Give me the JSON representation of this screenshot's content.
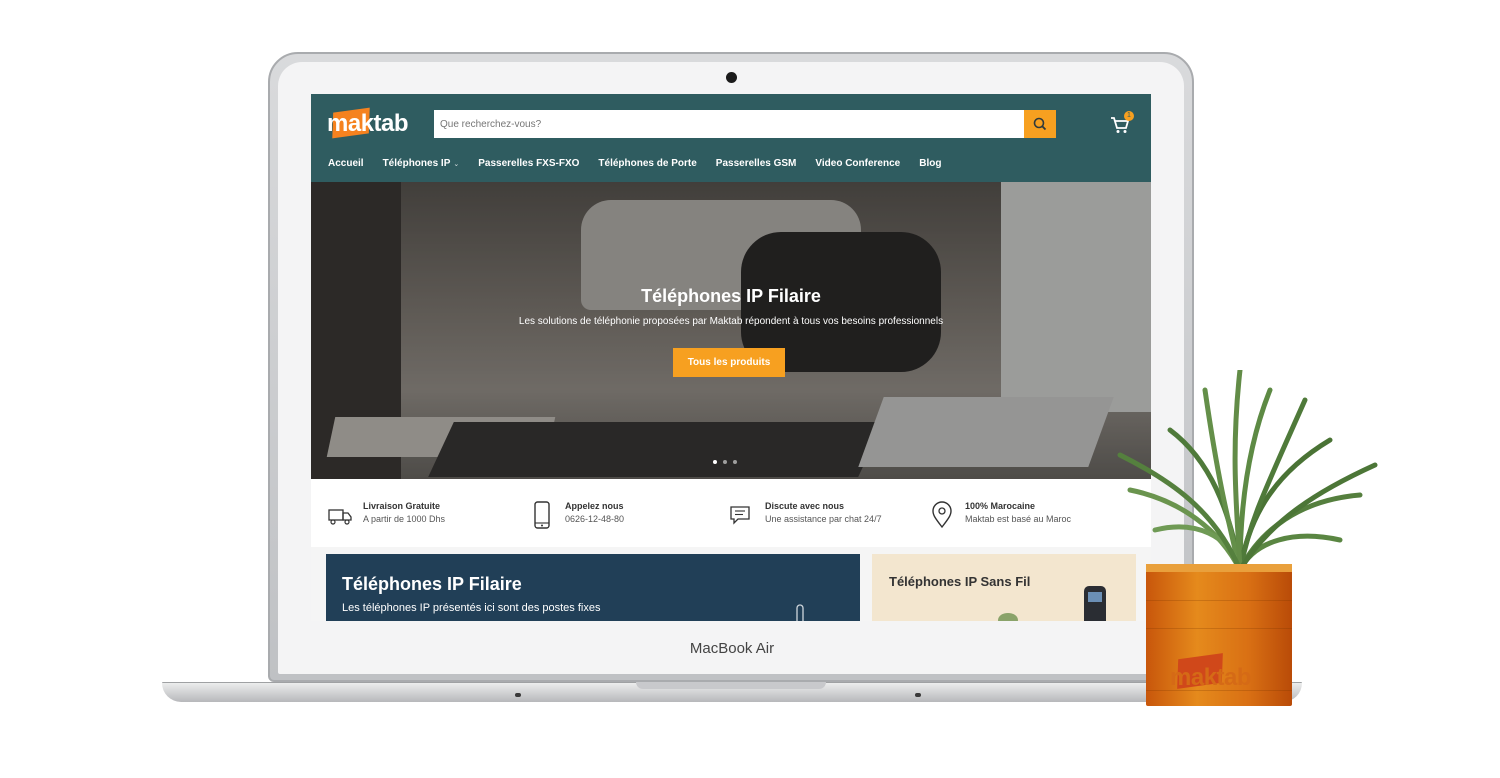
{
  "laptop": {
    "brand": "MacBook",
    "model": "Air"
  },
  "site": {
    "logo": "maktab",
    "search": {
      "placeholder": "Que recherchez-vous?"
    },
    "cart": {
      "count": "1"
    },
    "nav": [
      {
        "label": "Accueil"
      },
      {
        "label": "Téléphones IP",
        "caret": "⌄"
      },
      {
        "label": "Passerelles FXS-FXO"
      },
      {
        "label": "Téléphones de Porte"
      },
      {
        "label": "Passerelles GSM"
      },
      {
        "label": "Video Conference"
      },
      {
        "label": "Blog"
      }
    ],
    "hero": {
      "title": "Téléphones IP Filaire",
      "subtitle": "Les solutions de téléphonie proposées par Maktab répondent à tous vos besoins professionnels",
      "button": "Tous les produits",
      "slide_count": 3,
      "active_slide": 1
    },
    "features": [
      {
        "icon": "truck-icon",
        "title": "Livraison Gratuite",
        "subtitle": "A partir de 1000 Dhs"
      },
      {
        "icon": "phone-icon",
        "title": "Appelez nous",
        "subtitle": "0626-12-48-80"
      },
      {
        "icon": "chat-icon",
        "title": "Discute avec nous",
        "subtitle": "Une assistance par chat 24/7"
      },
      {
        "icon": "location-pin-icon",
        "title": "100% Marocaine",
        "subtitle": "Maktab est basé au Maroc"
      }
    ],
    "promo_cards": [
      {
        "title": "Téléphones IP Filaire",
        "subtitle": "Les téléphones IP présentés ici sont des postes fixes"
      },
      {
        "title": "Téléphones IP Sans Fil"
      }
    ]
  },
  "pot": {
    "logo": "maktab"
  },
  "colors": {
    "header": "#2f5c60",
    "accent": "#f7a020",
    "card_dark": "#213f57",
    "card_light": "#f3e6cf"
  }
}
